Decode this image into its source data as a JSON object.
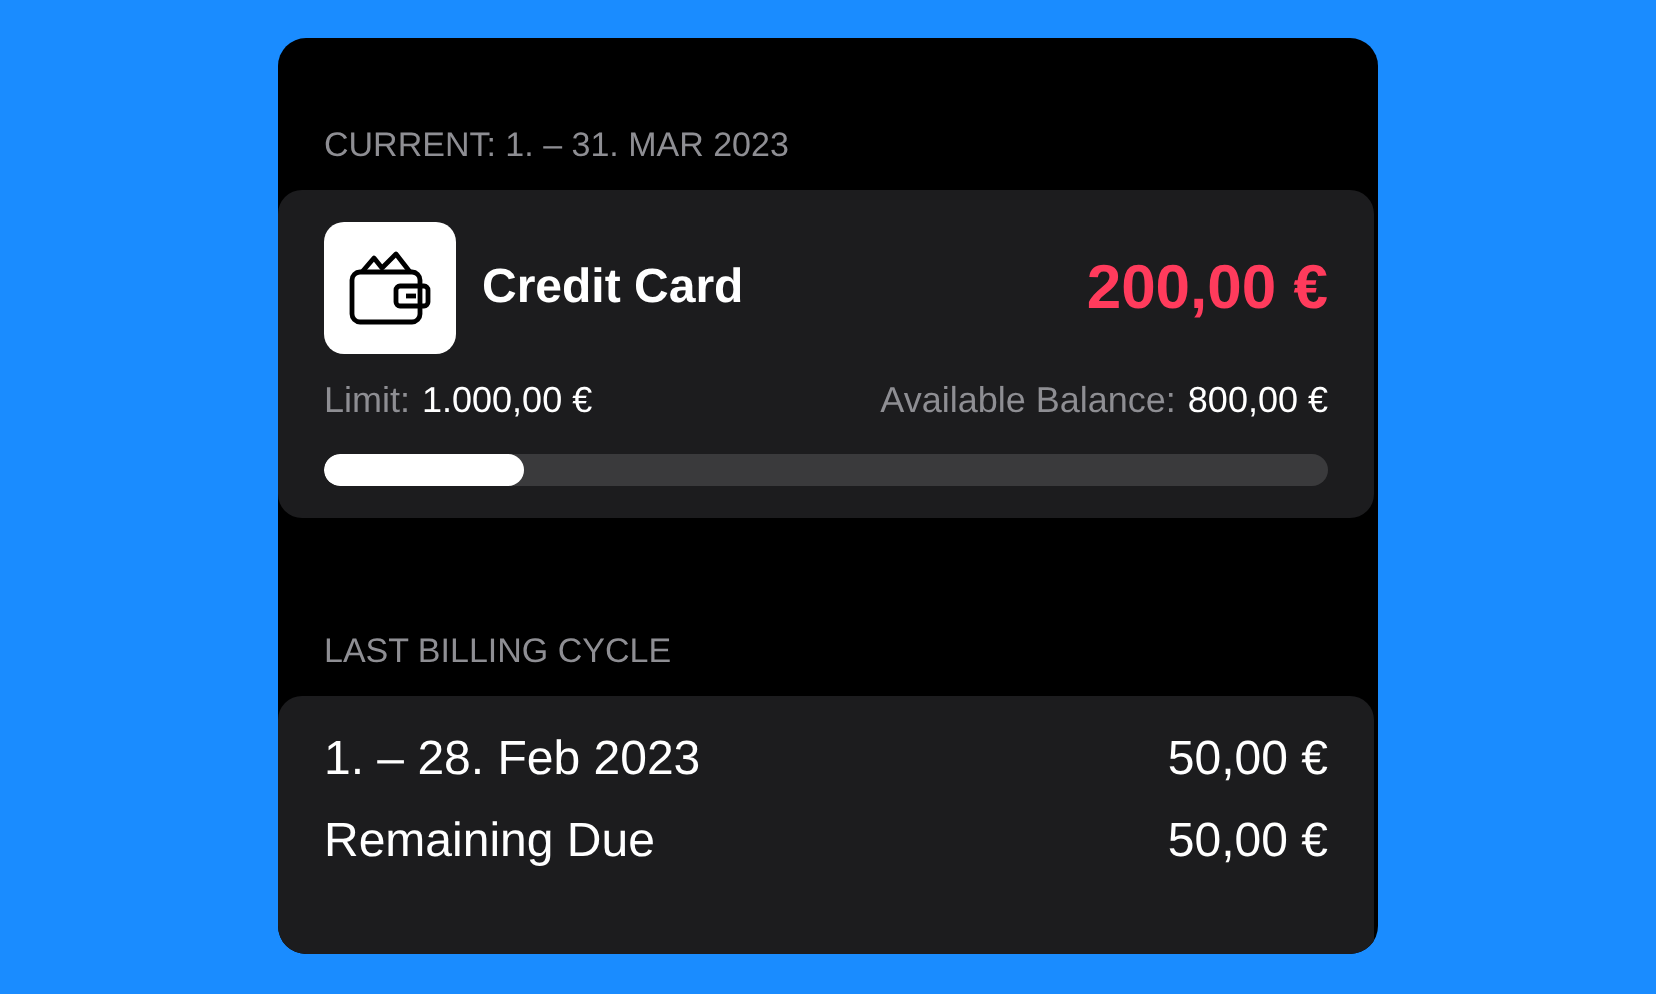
{
  "current_header": "CURRENT: 1. – 31. MAR 2023",
  "account": {
    "name": "Credit Card",
    "amount": "200,00 €",
    "limit_label": "Limit:",
    "limit": "1.000,00 €",
    "available_label": "Available Balance:",
    "available": "800,00 €",
    "level": 0.2
  },
  "last_cycle_header": "LAST BILLING CYCLE",
  "last_cycle_rows": [
    {
      "label": "1. – 28. Feb 2023",
      "value": "50,00 €"
    },
    {
      "label": "Remaining Due",
      "value": "50,00 €"
    }
  ]
}
